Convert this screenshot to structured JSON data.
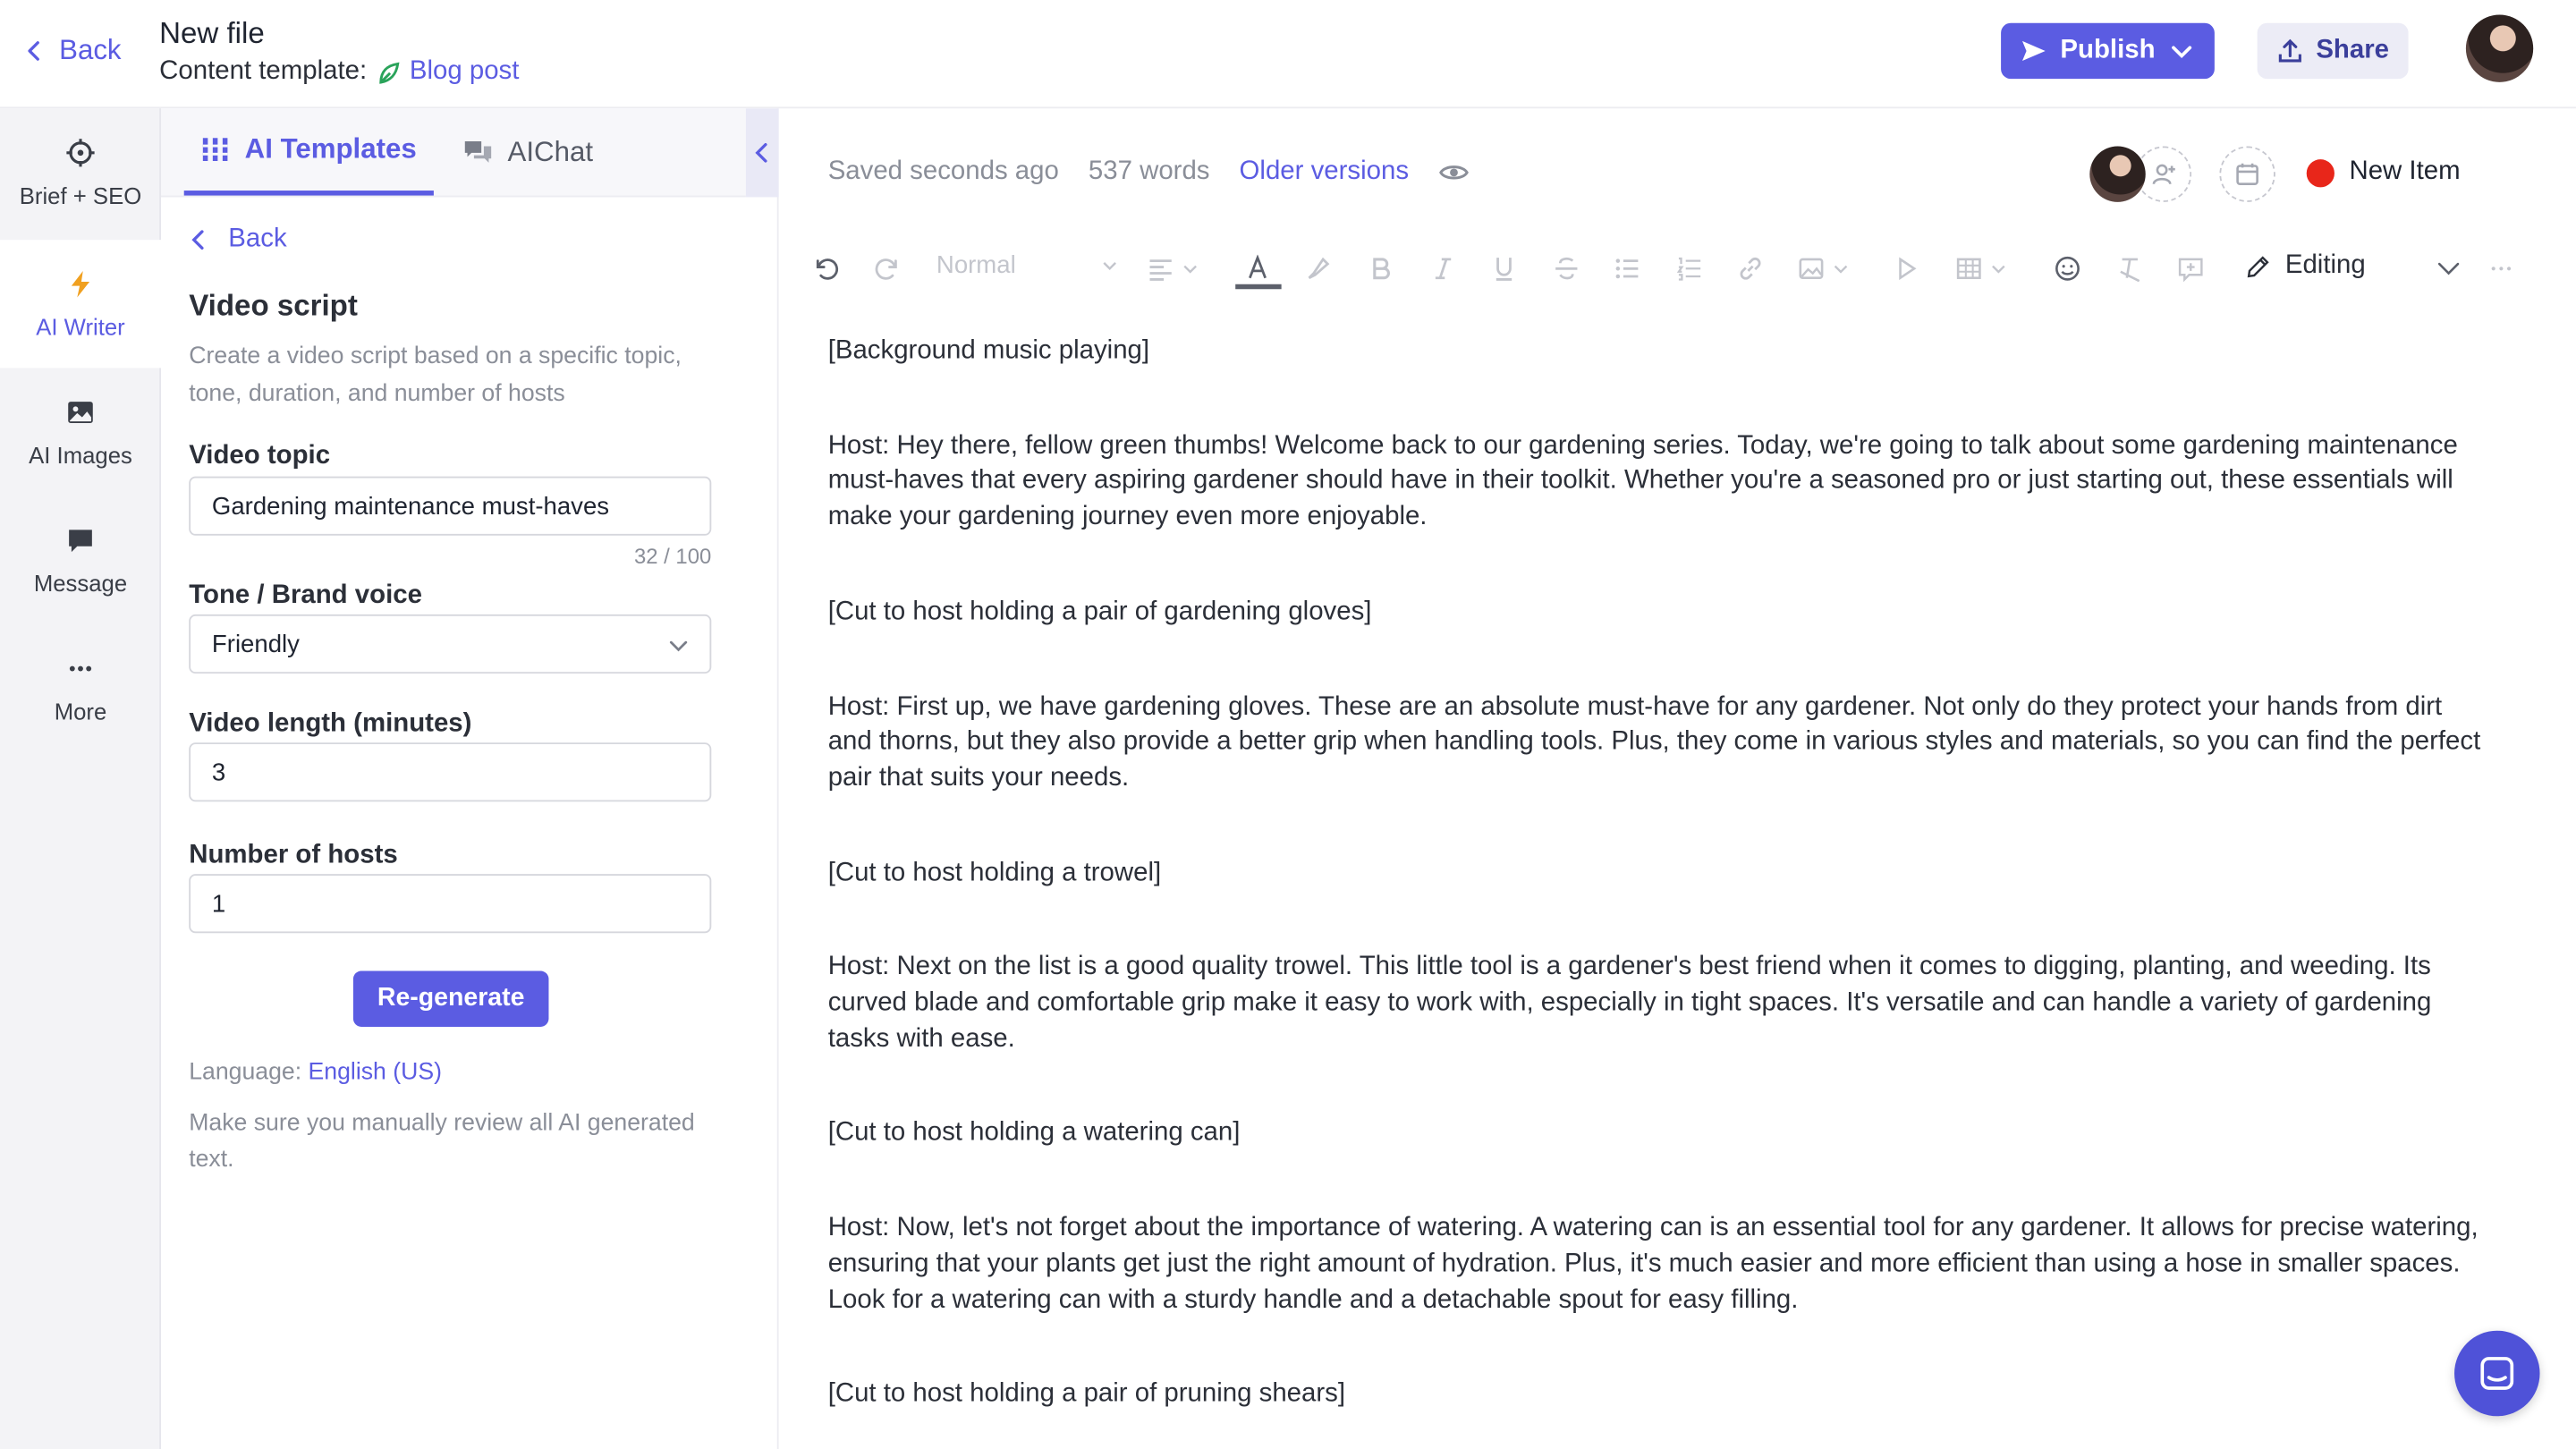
{
  "header": {
    "back_label": "Back",
    "file_title": "New file",
    "template_prefix": "Content template:",
    "template_name": "Blog post",
    "publish_label": "Publish",
    "share_label": "Share"
  },
  "leftnav": {
    "items": [
      {
        "label": "Brief + SEO",
        "icon": "crosshair-icon"
      },
      {
        "label": "AI Writer",
        "icon": "lightning-icon"
      },
      {
        "label": "AI Images",
        "icon": "image-icon"
      },
      {
        "label": "Message",
        "icon": "chat-bubble-icon"
      },
      {
        "label": "More",
        "icon": "ellipsis-icon"
      }
    ],
    "active": "AI Writer"
  },
  "panel": {
    "tabs": [
      {
        "label": "AI Templates",
        "icon": "templates-icon"
      },
      {
        "label": "AIChat",
        "icon": "chat-icon"
      }
    ],
    "back_label": "Back",
    "title": "Video script",
    "description": "Create a video script based on a specific topic, tone, duration, and number of hosts",
    "topic_label": "Video topic",
    "topic_value": "Gardening maintenance must-haves",
    "topic_counter": "32 / 100",
    "tone_label": "Tone / Brand voice",
    "tone_value": "Friendly",
    "length_label": "Video length (minutes)",
    "length_value": "3",
    "hosts_label": "Number of hosts",
    "hosts_value": "1",
    "regenerate_label": "Re-generate",
    "language_prefix": "Language:",
    "language_value": "English (US)",
    "review_note": "Make sure you manually review all AI generated text."
  },
  "editor": {
    "saved_status": "Saved seconds ago",
    "word_count": "537 words",
    "older_versions": "Older versions",
    "status_item": "New Item",
    "status_color": "#e8261a",
    "style_select": "Normal",
    "editing_mode": "Editing",
    "paragraphs": [
      "[Background music playing]",
      "Host: Hey there, fellow green thumbs! Welcome back to our gardening series. Today, we're going to talk about some gardening maintenance must-haves that every aspiring gardener should have in their toolkit. Whether you're a seasoned pro or just starting out, these essentials will make your gardening journey even more enjoyable.",
      "[Cut to host holding a pair of gardening gloves]",
      "Host: First up, we have gardening gloves. These are an absolute must-have for any gardener. Not only do they protect your hands from dirt and thorns, but they also provide a better grip when handling tools. Plus, they come in various styles and materials, so you can find the perfect pair that suits your needs.",
      "[Cut to host holding a trowel]",
      "Host: Next on the list is a good quality trowel. This little tool is a gardener's best friend when it comes to digging, planting, and weeding. Its curved blade and comfortable grip make it easy to work with, especially in tight spaces. It's versatile and can handle a variety of gardening tasks with ease.",
      "[Cut to host holding a watering can]",
      "Host: Now, let's not forget about the importance of watering. A watering can is an essential tool for any gardener. It allows for precise watering, ensuring that your plants get just the right amount of hydration. Plus, it's much easier and more efficient than using a hose in smaller spaces. Look for a watering can with a sturdy handle and a detachable spout for easy filling.",
      "[Cut to host holding a pair of pruning shears]"
    ]
  },
  "colors": {
    "accent": "#5b5ce2",
    "sidebar_bg": "#f3f3f6",
    "muted_text": "#8a8e98"
  }
}
